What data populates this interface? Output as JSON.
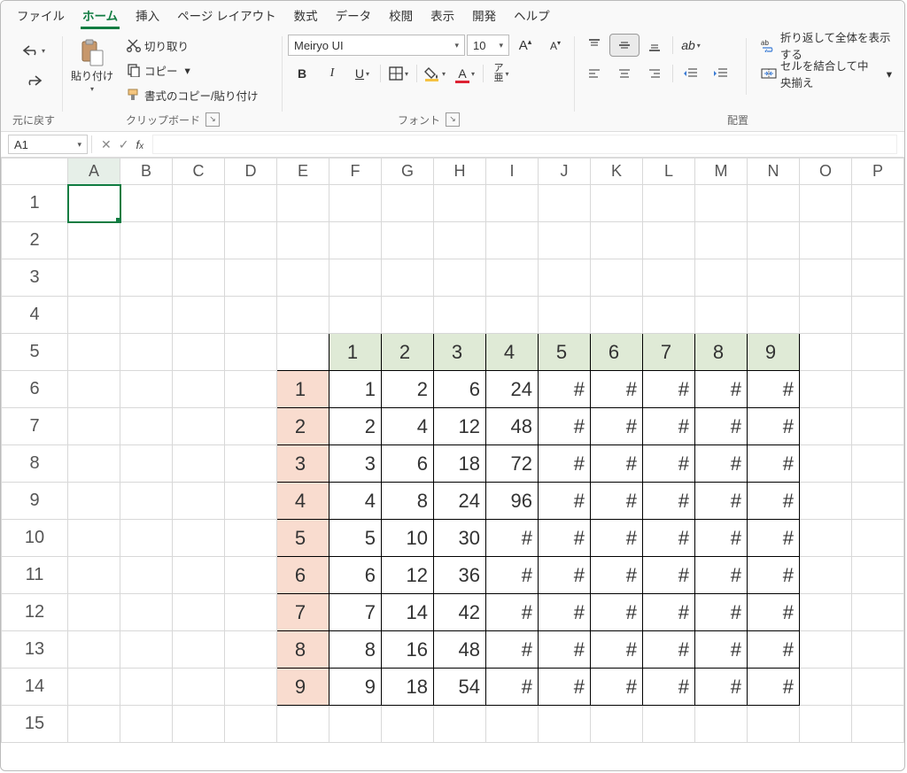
{
  "menubar": {
    "items": [
      {
        "label": "ファイル",
        "active": false
      },
      {
        "label": "ホーム",
        "active": true
      },
      {
        "label": "挿入",
        "active": false
      },
      {
        "label": "ページ レイアウト",
        "active": false
      },
      {
        "label": "数式",
        "active": false
      },
      {
        "label": "データ",
        "active": false
      },
      {
        "label": "校閲",
        "active": false
      },
      {
        "label": "表示",
        "active": false
      },
      {
        "label": "開発",
        "active": false
      },
      {
        "label": "ヘルプ",
        "active": false
      }
    ]
  },
  "ribbon": {
    "undo": {
      "group_label": "元に戻す"
    },
    "clipboard": {
      "paste_label": "貼り付け",
      "cut_label": "切り取り",
      "copy_label": "コピー",
      "format_painter_label": "書式のコピー/貼り付け",
      "group_label": "クリップボード"
    },
    "font": {
      "name": "Meiryo UI",
      "size": "10",
      "group_label": "フォント"
    },
    "alignment": {
      "wrap_label": "折り返して全体を表示する",
      "merge_label": "セルを結合して中央揃え",
      "group_label": "配置"
    }
  },
  "formula_bar": {
    "namebox_value": "A1",
    "formula_value": ""
  },
  "grid": {
    "columns": [
      "A",
      "B",
      "C",
      "D",
      "E",
      "F",
      "G",
      "H",
      "I",
      "J",
      "K",
      "L",
      "M",
      "N",
      "O",
      "P"
    ],
    "rows": [
      "1",
      "2",
      "3",
      "4",
      "5",
      "6",
      "7",
      "8",
      "9",
      "10",
      "11",
      "12",
      "13",
      "14",
      "15"
    ],
    "active_cell": "A1"
  },
  "inner_table": {
    "top_headers": [
      "1",
      "2",
      "3",
      "4",
      "5",
      "6",
      "7",
      "8",
      "9"
    ],
    "left_headers": [
      "1",
      "2",
      "3",
      "4",
      "5",
      "6",
      "7",
      "8",
      "9"
    ],
    "cells": [
      [
        "1",
        "2",
        "6",
        "24",
        "#",
        "#",
        "#",
        "#",
        "#"
      ],
      [
        "2",
        "4",
        "12",
        "48",
        "#",
        "#",
        "#",
        "#",
        "#"
      ],
      [
        "3",
        "6",
        "18",
        "72",
        "#",
        "#",
        "#",
        "#",
        "#"
      ],
      [
        "4",
        "8",
        "24",
        "96",
        "#",
        "#",
        "#",
        "#",
        "#"
      ],
      [
        "5",
        "10",
        "30",
        "#",
        "#",
        "#",
        "#",
        "#",
        "#"
      ],
      [
        "6",
        "12",
        "36",
        "#",
        "#",
        "#",
        "#",
        "#",
        "#"
      ],
      [
        "7",
        "14",
        "42",
        "#",
        "#",
        "#",
        "#",
        "#",
        "#"
      ],
      [
        "8",
        "16",
        "48",
        "#",
        "#",
        "#",
        "#",
        "#",
        "#"
      ],
      [
        "9",
        "18",
        "54",
        "#",
        "#",
        "#",
        "#",
        "#",
        "#"
      ]
    ],
    "start_col_index": 4,
    "start_row_index": 4
  }
}
